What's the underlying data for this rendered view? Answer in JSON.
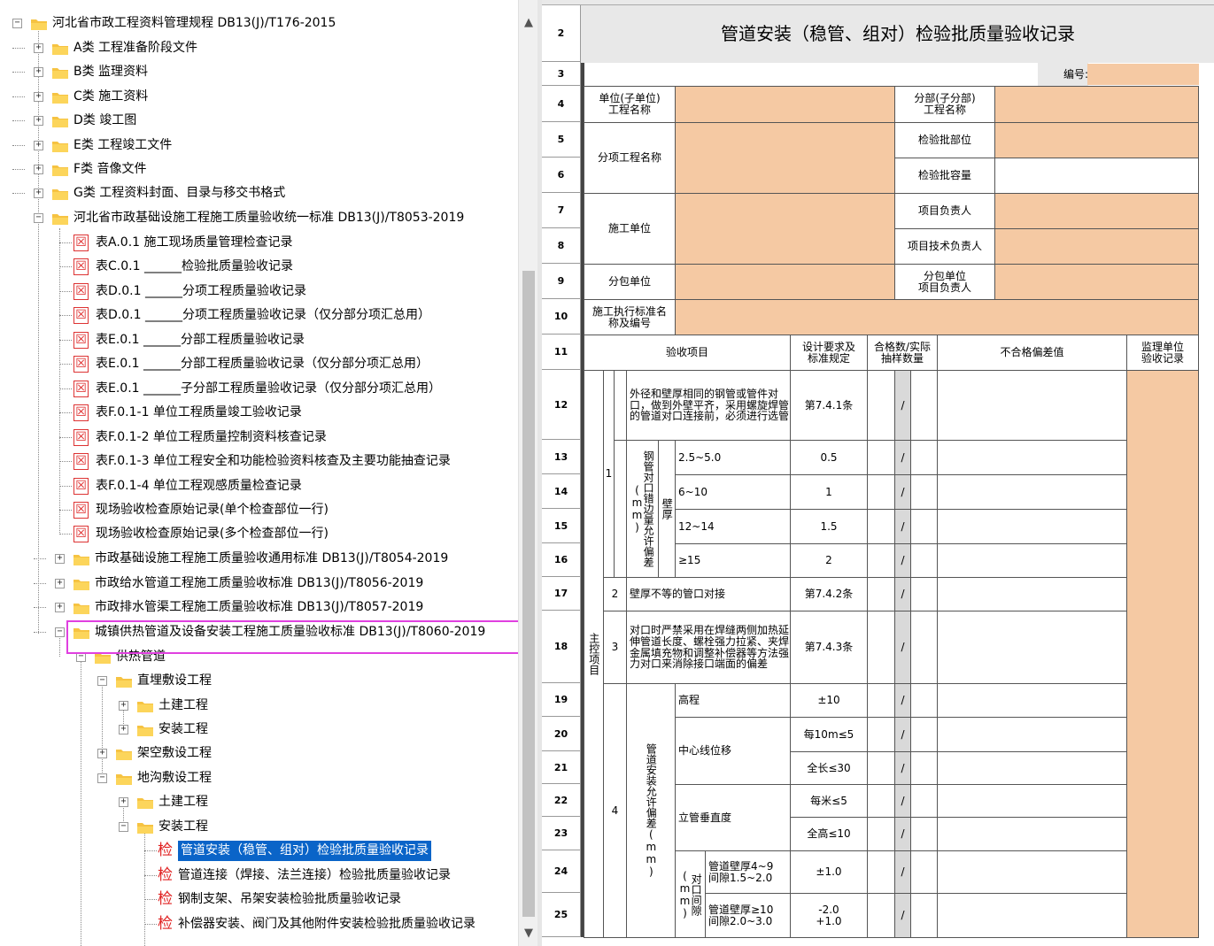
{
  "tree": {
    "root": {
      "label": "河北省市政工程资料管理规程 DB13(J)/T176-2015"
    },
    "categories": [
      {
        "label": "A类 工程准备阶段文件"
      },
      {
        "label": "B类 监理资料"
      },
      {
        "label": "C类 施工资料"
      },
      {
        "label": "D类 竣工图"
      },
      {
        "label": "E类 工程竣工文件"
      },
      {
        "label": "F类 音像文件"
      },
      {
        "label": "G类 工程资料封面、目录与移交书格式"
      }
    ],
    "standard_unified": {
      "label": "河北省市政基础设施工程施工质量验收统一标准 DB13(J)/T8053-2019"
    },
    "forms": [
      {
        "label": "表A.0.1 施工现场质量管理检查记录"
      },
      {
        "label": "表C.0.1 ______检验批质量验收记录"
      },
      {
        "label": "表D.0.1 ______分项工程质量验收记录"
      },
      {
        "label": "表D.0.1 ______分项工程质量验收记录（仅分部分项汇总用）"
      },
      {
        "label": "表E.0.1 ______分部工程质量验收记录"
      },
      {
        "label": "表E.0.1 ______分部工程质量验收记录（仅分部分项汇总用）"
      },
      {
        "label": "表E.0.1 ______子分部工程质量验收记录（仅分部分项汇总用）"
      },
      {
        "label": "表F.0.1-1 单位工程质量竣工验收记录"
      },
      {
        "label": "表F.0.1-2 单位工程质量控制资料核查记录"
      },
      {
        "label": "表F.0.1-3 单位工程安全和功能检验资料核查及主要功能抽查记录"
      },
      {
        "label": "表F.0.1-4 单位工程观感质量检查记录"
      },
      {
        "label": "现场验收检查原始记录(单个检查部位一行)"
      },
      {
        "label": "现场验收检查原始记录(多个检查部位一行)"
      }
    ],
    "standards": [
      {
        "label": "市政基础设施工程施工质量验收通用标准 DB13(J)/T8054-2019"
      },
      {
        "label": "市政给水管道工程施工质量验收标准 DB13(J)/T8056-2019"
      },
      {
        "label": "市政排水管渠工程施工质量验收标准 DB13(J)/T8057-2019"
      },
      {
        "label": "城镇供热管道及设备安装工程施工质量验收标准 DB13(J)/T8060-2019"
      }
    ],
    "heating": {
      "label": "供热管道",
      "direct": {
        "label": "直埋敷设工程",
        "civil": "土建工程",
        "install": "安装工程"
      },
      "overhead": {
        "label": "架空敷设工程"
      },
      "trench": {
        "label": "地沟敷设工程",
        "civil": "土建工程",
        "install": "安装工程"
      }
    },
    "check_icon": "检",
    "checks": [
      {
        "label": "管道安装（稳管、组对）检验批质量验收记录"
      },
      {
        "label": "管道连接（焊接、法兰连接）检验批质量验收记录"
      },
      {
        "label": "钢制支架、吊架安装检验批质量验收记录"
      },
      {
        "label": "补偿器安装、阀门及其他附件安装检验批质量验收记录"
      }
    ]
  },
  "sheet": {
    "row_numbers": [
      "2",
      "3",
      "4",
      "5",
      "6",
      "7",
      "8",
      "9",
      "10",
      "11",
      "12",
      "13",
      "14",
      "15",
      "16",
      "17",
      "18",
      "19",
      "20",
      "21",
      "22",
      "23",
      "24",
      "25"
    ],
    "title": "管道安装（稳管、组对）检验批质量验收记录",
    "number_label": "编号:",
    "labels": {
      "unit_name": "单位(子单位)\n工程名称",
      "division_name": "分部(子分部)\n工程名称",
      "subitem_name": "分项工程名称",
      "batch_location": "检验批部位",
      "batch_capacity": "检验批容量",
      "contractor": "施工单位",
      "project_manager": "项目负责人",
      "tech_manager": "项目技术负责人",
      "subcontractor": "分包单位",
      "sub_manager": "分包单位\n项目负责人",
      "exec_standard": "施工执行标准名\n称及编号",
      "acceptance_item": "验收项目",
      "design_req": "设计要求及\n标准规定",
      "sample_count": "合格数/实际\n抽样数量",
      "deviation": "不合格偏差值",
      "supervisor": "监理单位\n验收记录",
      "main_control": "主控项目"
    },
    "items": {
      "n1": "1",
      "desc1": "外径和壁厚相同的钢管或管件对口，做到外壁平齐，采用螺旋焊管的管道对口连接前，必须进行选管",
      "req1": "第7.4.1条",
      "misalign": "钢管对口错边量允许偏差(mm)",
      "wall": "壁厚",
      "w1": "2.5~5.0",
      "r1": "0.5",
      "w2": "6~10",
      "r2": "1",
      "w3": "12~14",
      "r3": "1.5",
      "w4": "≥15",
      "r4": "2",
      "n2": "2",
      "desc2": "壁厚不等的管口对接",
      "req2": "第7.4.2条",
      "n3": "3",
      "desc3": "对口时严禁采用在焊缝两侧加热延伸管道长度、螺栓强力拉紧、夹焊金属填充物和调整补偿器等方法强力对口来消除接口端面的偏差",
      "req3": "第7.4.3条",
      "n4": "4",
      "tol": "管道安装允许偏差(mm)",
      "elev": "高程",
      "elev_req": "±10",
      "center": "中心线位移",
      "center_req1": "每10m≤5",
      "center_req2": "全长≤30",
      "vertical": "立管垂直度",
      "vert_req1": "每米≤5",
      "vert_req2": "全高≤10",
      "gap": "对口间隙(mm)",
      "gap1": "管道壁厚4~9\n间隙1.5~2.0",
      "gap1_req": "±1.0",
      "gap2": "管道壁厚≥10\n间隙2.0~3.0",
      "gap2_req": "-2.0\n+1.0",
      "slash": "/"
    }
  }
}
